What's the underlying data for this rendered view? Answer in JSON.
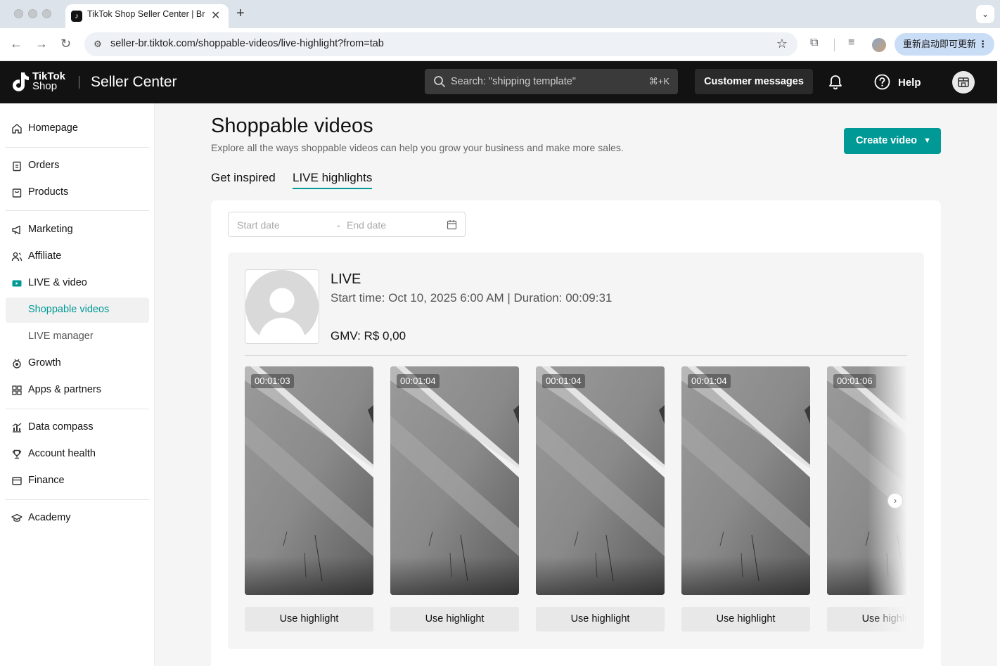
{
  "browser": {
    "tab_title": "TikTok Shop Seller Center | Br",
    "url": "seller-br.tiktok.com/shoppable-videos/live-highlight?from=tab",
    "update_label": "重新启动即可更新"
  },
  "header": {
    "brand_top": "TikTok",
    "brand_bottom": "Shop",
    "app_name": "Seller Center",
    "search_placeholder": "Search: \"shipping template\"",
    "search_shortcut": "⌘+K",
    "customer_messages": "Customer messages",
    "help": "Help"
  },
  "sidebar": {
    "items": [
      {
        "label": "Homepage",
        "icon": "home-icon"
      },
      {
        "label": "Orders",
        "icon": "clipboard-icon"
      },
      {
        "label": "Products",
        "icon": "shopping-bag-icon"
      },
      {
        "label": "Marketing",
        "icon": "megaphone-icon"
      },
      {
        "label": "Affiliate",
        "icon": "people-icon"
      },
      {
        "label": "LIVE & video",
        "icon": "live-video-icon"
      },
      {
        "label": "Shoppable videos"
      },
      {
        "label": "LIVE manager"
      },
      {
        "label": "Growth",
        "icon": "medal-icon"
      },
      {
        "label": "Apps & partners",
        "icon": "apps-grid-icon"
      },
      {
        "label": "Data compass",
        "icon": "bar-chart-icon"
      },
      {
        "label": "Account health",
        "icon": "trophy-icon"
      },
      {
        "label": "Finance",
        "icon": "wallet-icon"
      },
      {
        "label": "Academy",
        "icon": "graduation-cap-icon"
      }
    ]
  },
  "page": {
    "title": "Shoppable videos",
    "subtitle": "Explore all the ways shoppable videos can help you grow your business and make more sales.",
    "create_button": "Create video",
    "tabs": [
      {
        "label": "Get inspired",
        "active": false
      },
      {
        "label": "LIVE highlights",
        "active": true
      }
    ],
    "date_start_placeholder": "Start date",
    "date_separator": "-",
    "date_end_placeholder": "End date"
  },
  "live": {
    "label": "LIVE",
    "meta": "Start time: Oct 10, 2025 6:00 AM | Duration: 00:09:31",
    "gmv": "GMV: R$ 0,00",
    "clips": [
      {
        "duration": "00:01:03",
        "button": "Use highlight"
      },
      {
        "duration": "00:01:04",
        "button": "Use highlight"
      },
      {
        "duration": "00:01:04",
        "button": "Use highlight"
      },
      {
        "duration": "00:01:04",
        "button": "Use highlight"
      },
      {
        "duration": "00:01:06",
        "button": "Use highlight"
      }
    ]
  },
  "colors": {
    "brand_teal": "#009995",
    "header_bg": "#121212",
    "page_bg": "#f5f5f5"
  }
}
